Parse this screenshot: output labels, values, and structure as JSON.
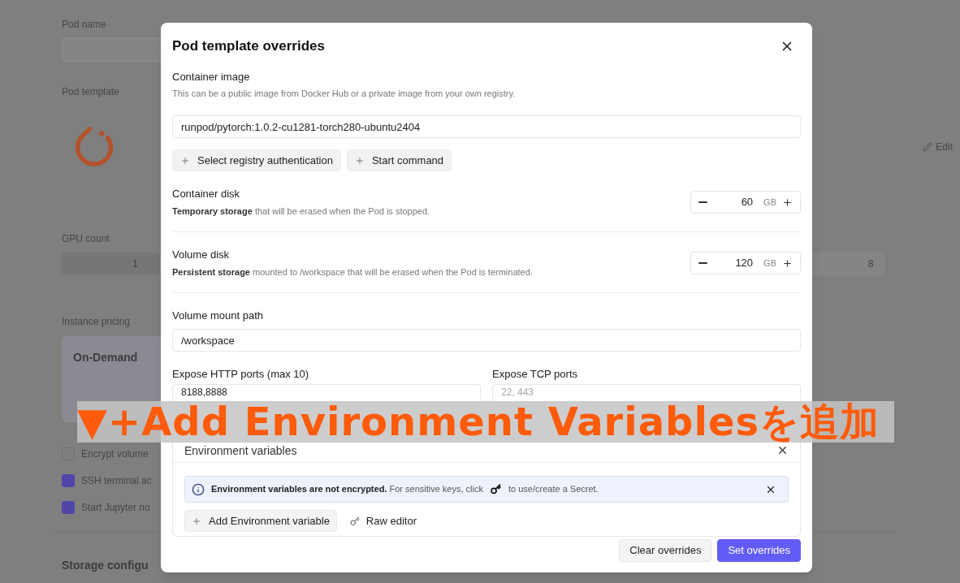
{
  "background": {
    "pod_name": {
      "label": "Pod name"
    },
    "pod_template": {
      "label": "Pod template",
      "edit_button": "Edit"
    },
    "gpu_count": {
      "label": "GPU count",
      "options": [
        {
          "label": "1",
          "selected": true
        },
        {
          "label": "8",
          "selected": false
        }
      ]
    },
    "instance_pricing": {
      "label": "Instance pricing",
      "plan": "On-Demand"
    },
    "options": [
      {
        "label": "Encrypt volume",
        "checked": false
      },
      {
        "label": "SSH terminal ac",
        "checked": true
      },
      {
        "label": "Start Jupyter no",
        "checked": true
      }
    ],
    "next_section": "Storage configu"
  },
  "dialog": {
    "title": "Pod template overrides",
    "container_image": {
      "label": "Container image",
      "hint": "This can be a public image from Docker Hub or a private image from your own registry.",
      "value": "runpod/pytorch:1.0.2-cu1281-torch280-ubuntu2404"
    },
    "image_buttons": [
      "Select registry authentication",
      "Start command"
    ],
    "disks": [
      {
        "label": "Container disk",
        "description": "**Temporary storage** that will be erased when the Pod is stopped.",
        "value": "60",
        "unit": "GB"
      },
      {
        "label": "Volume disk",
        "description": "**Persistent storage** mounted to /workspace that will be erased when the Pod is terminated.",
        "value": "120",
        "unit": "GB"
      }
    ],
    "volume_mount_path": {
      "label": "Volume mount path",
      "value": "/workspace"
    },
    "ports": [
      {
        "label": "Expose HTTP ports (max 10)",
        "value": "8188,8888"
      },
      {
        "label": "Expose TCP ports",
        "placeholder": "22, 443"
      }
    ],
    "environment": {
      "title": "Environment variables",
      "notice": "**Environment variables are not encrypted.** For sensitive keys, click",
      "notice_end": "to use/create a Secret.",
      "actions": [
        {
          "kind": "add",
          "label": "Add Environment variable"
        },
        {
          "kind": "raw",
          "label": "Raw editor"
        }
      ]
    },
    "footer_buttons": [
      {
        "kind": "secondary",
        "label": "Clear overrides"
      },
      {
        "kind": "primary",
        "label": "Set overrides"
      }
    ]
  },
  "caption": "▼+Add Environment Variablesを追加"
}
